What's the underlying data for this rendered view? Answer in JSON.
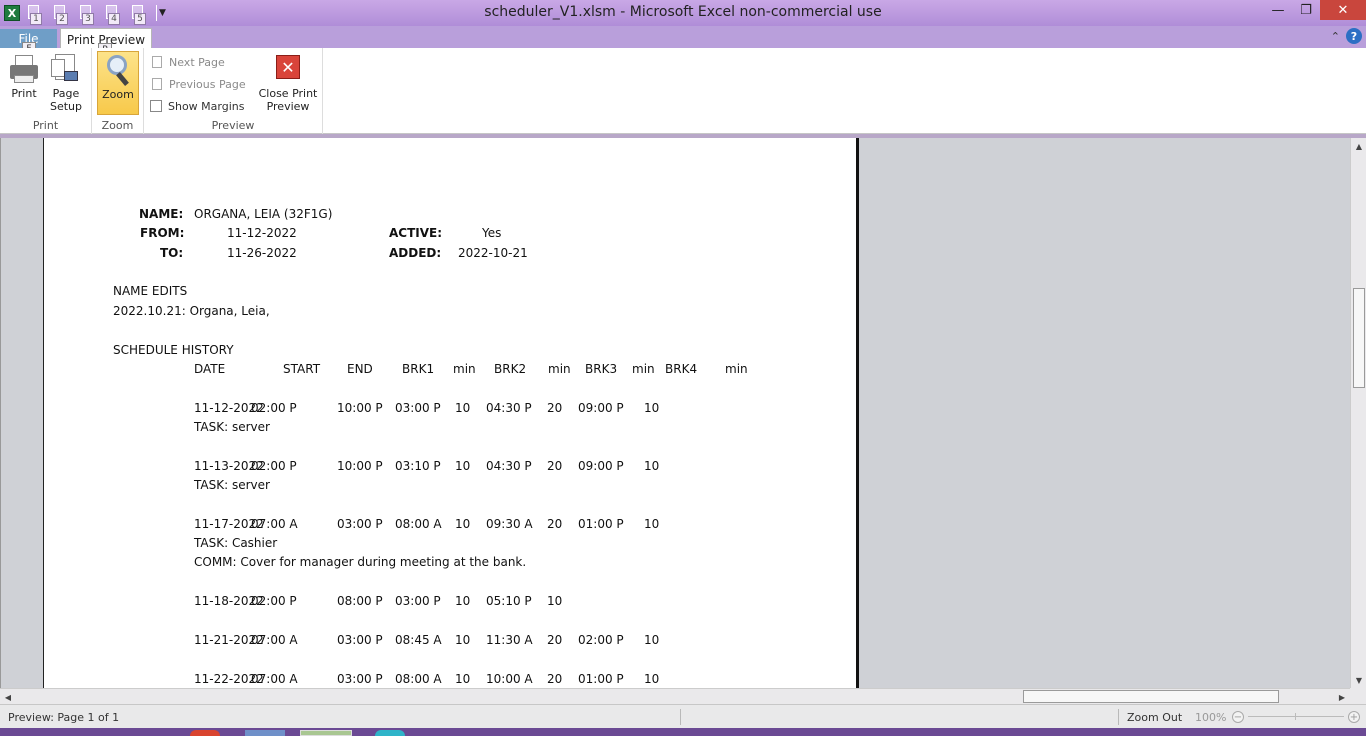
{
  "window": {
    "title": "scheduler_V1.xlsm  -  Microsoft Excel non-commercial use",
    "app_icon_letter": "X",
    "qat_keys": [
      "1",
      "2",
      "3",
      "4",
      "5"
    ]
  },
  "ribbon": {
    "tabs": {
      "file": "File",
      "file_key": "F",
      "print_preview": "Print Preview",
      "print_preview_key": "P"
    },
    "groups": {
      "print": {
        "label": "Print",
        "print_btn": "Print",
        "setup_btn_line1": "Page",
        "setup_btn_line2": "Setup"
      },
      "zoom": {
        "label": "Zoom",
        "zoom_btn": "Zoom"
      },
      "preview": {
        "label": "Preview",
        "next_page": "Next Page",
        "previous_page": "Previous Page",
        "show_margins": "Show Margins",
        "close_line1": "Close Print",
        "close_line2": "Preview"
      }
    }
  },
  "page": {
    "header": {
      "name_label": "NAME:",
      "name_value": "ORGANA, LEIA (32F1G)",
      "from_label": "FROM:",
      "from_value": "11-12-2022",
      "to_label": "TO:",
      "to_value": "11-26-2022",
      "active_label": "ACTIVE:",
      "active_value": "Yes",
      "added_label": "ADDED:",
      "added_value": "2022-10-21"
    },
    "name_edits_title": "NAME EDITS",
    "name_edits_line": "2022.10.21: Organa, Leia,",
    "schedule_title": "SCHEDULE HISTORY",
    "columns": [
      "DATE",
      "START",
      "END",
      "BRK1",
      "min",
      "BRK2",
      "min",
      "BRK3",
      "min",
      "BRK4",
      "min"
    ],
    "rows": [
      {
        "date": "11-12-2022",
        "start": "02:00 P",
        "end": "10:00 P",
        "brk1": "03:00 P",
        "min1": "10",
        "brk2": "04:30 P",
        "min2": "20",
        "brk3": "09:00 P",
        "min3": "10",
        "task": "TASK: server",
        "comm": ""
      },
      {
        "date": "11-13-2022",
        "start": "02:00 P",
        "end": "10:00 P",
        "brk1": "03:10 P",
        "min1": "10",
        "brk2": "04:30 P",
        "min2": "20",
        "brk3": "09:00 P",
        "min3": "10",
        "task": "TASK: server",
        "comm": ""
      },
      {
        "date": "11-17-2022",
        "start": "07:00 A",
        "end": "03:00 P",
        "brk1": "08:00 A",
        "min1": "10",
        "brk2": "09:30 A",
        "min2": "20",
        "brk3": "01:00 P",
        "min3": "10",
        "task": "TASK: Cashier",
        "comm": "COMM: Cover for manager during meeting at the bank."
      },
      {
        "date": "11-18-2022",
        "start": "02:00 P",
        "end": "08:00 P",
        "brk1": "03:00 P",
        "min1": "10",
        "brk2": "05:10 P",
        "min2": "10",
        "brk3": "",
        "min3": "",
        "task": "",
        "comm": ""
      },
      {
        "date": "11-21-2022",
        "start": "07:00 A",
        "end": "03:00 P",
        "brk1": "08:45 A",
        "min1": "10",
        "brk2": "11:30 A",
        "min2": "20",
        "brk3": "02:00 P",
        "min3": "10",
        "task": "",
        "comm": ""
      },
      {
        "date": "11-22-2022",
        "start": "07:00 A",
        "end": "03:00 P",
        "brk1": "08:00 A",
        "min1": "10",
        "brk2": "10:00 A",
        "min2": "20",
        "brk3": "01:00 P",
        "min3": "10",
        "task": "",
        "comm": ""
      }
    ]
  },
  "statusbar": {
    "preview_text": "Preview: Page 1 of 1",
    "zoom_out": "Zoom Out",
    "zoom_pct": "100%"
  },
  "colors": {
    "titlebar": "#b08dd8",
    "file_tab": "#6f9ec7",
    "close_button": "#c9463d",
    "zoom_active": "#f7c94a"
  }
}
